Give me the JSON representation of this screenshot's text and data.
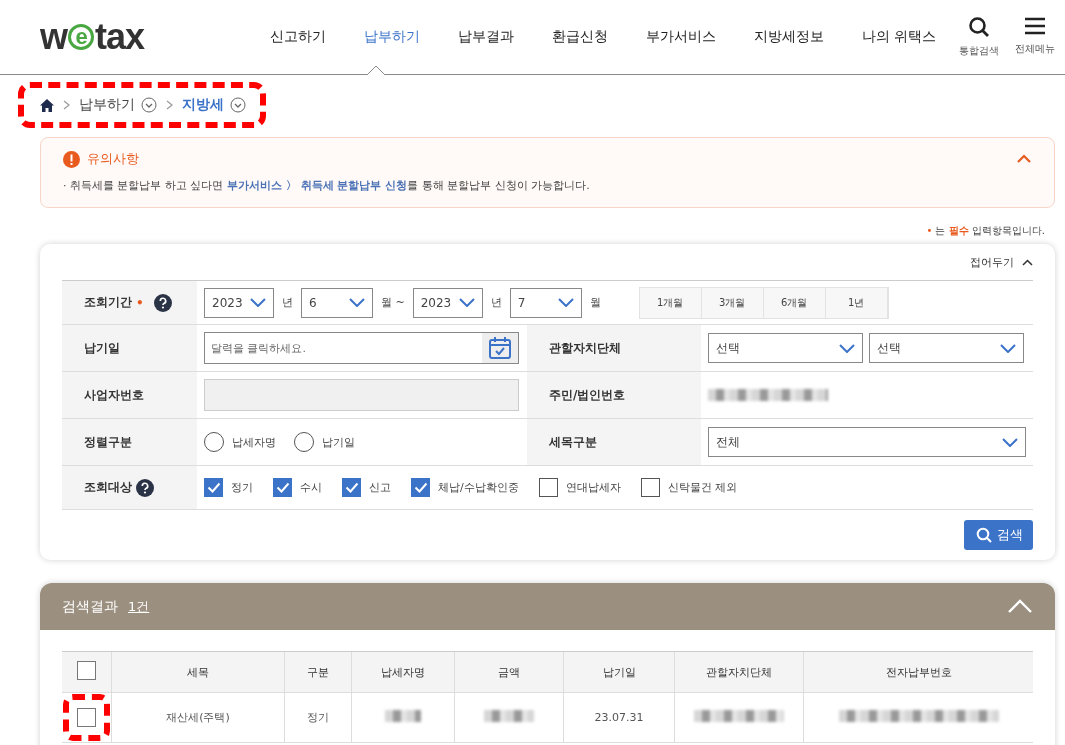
{
  "logo": {
    "lead": "w",
    "mark": "e",
    "tail": "tax"
  },
  "nav": [
    {
      "label": "신고하기",
      "selected": false
    },
    {
      "label": "납부하기",
      "selected": true
    },
    {
      "label": "납부결과",
      "selected": false
    },
    {
      "label": "환급신청",
      "selected": false
    },
    {
      "label": "부가서비스",
      "selected": false
    },
    {
      "label": "지방세정보",
      "selected": false
    },
    {
      "label": "나의 위택스",
      "selected": false
    }
  ],
  "header_tools": [
    {
      "kind": "search",
      "label": "통합검색"
    },
    {
      "kind": "menu",
      "label": "전체메뉴"
    }
  ],
  "breadcrumb": [
    {
      "label": "납부하기",
      "current": false
    },
    {
      "label": "지방세",
      "current": true
    }
  ],
  "notice": {
    "title": "유의사항",
    "expanded": true,
    "text": "· 취득세를 분할납부 하고 싶다면 **부가서비스 〉 취득세 분할납부 신청**를 통해 분할납부 신청이 가능합니다."
  },
  "required_note": {
    "mark": "•",
    "text": "는 **필수** 입력항목입니다."
  },
  "search_form": {
    "collapse_label": "접어두기",
    "expanded": true,
    "period": {
      "label": "조회기간",
      "required": true,
      "selects": [
        {
          "value": "2023",
          "unit": "년"
        },
        {
          "value": "6",
          "unit": "월 ~"
        },
        {
          "value": "2023",
          "unit": "년"
        },
        {
          "value": "7",
          "unit": "월"
        }
      ],
      "quick": [
        {
          "label": "1개월",
          "selected": false
        },
        {
          "label": "3개월",
          "selected": false
        },
        {
          "label": "6개월",
          "selected": false
        },
        {
          "label": "1년",
          "selected": false
        }
      ]
    },
    "due_date": {
      "label": "납기일",
      "placeholder": "달력을 클릭하세요."
    },
    "region": {
      "label": "관할자치단체",
      "selects": [
        "선택",
        "선택"
      ]
    },
    "business_no": {
      "label": "사업자번호",
      "disabled": true
    },
    "resident_no": {
      "label": "주민/법인번호"
    },
    "sort": {
      "label": "정렬구분",
      "options": [
        {
          "label": "납세자명",
          "selected": false
        },
        {
          "label": "납기일",
          "selected": false
        }
      ]
    },
    "tax_type": {
      "label": "세목구분",
      "value": "전체"
    },
    "targets": {
      "label": "조회대상",
      "options": [
        {
          "label": "정기",
          "checked": true
        },
        {
          "label": "수시",
          "checked": true
        },
        {
          "label": "신고",
          "checked": true
        },
        {
          "label": "체납/수납확인중",
          "checked": true
        },
        {
          "label": "연대납세자",
          "checked": false
        },
        {
          "label": "신탁물건 제외",
          "checked": false
        }
      ]
    },
    "search_button": "검색"
  },
  "results": {
    "title": "검색결과",
    "count": "1건",
    "expanded": true,
    "select_all": false,
    "columns": [
      "세목",
      "구분",
      "납세자명",
      "금액",
      "납기일",
      "관할자치단체",
      "전자납부번호"
    ],
    "rows": [
      {
        "checked": false,
        "cells": [
          {
            "kind": "text",
            "text": "재산세(주택)"
          },
          {
            "kind": "text",
            "text": "정기"
          },
          {
            "kind": "redacted"
          },
          {
            "kind": "redacted"
          },
          {
            "kind": "text",
            "text": "23.07.31"
          },
          {
            "kind": "redacted"
          },
          {
            "kind": "redacted"
          }
        ]
      }
    ]
  }
}
